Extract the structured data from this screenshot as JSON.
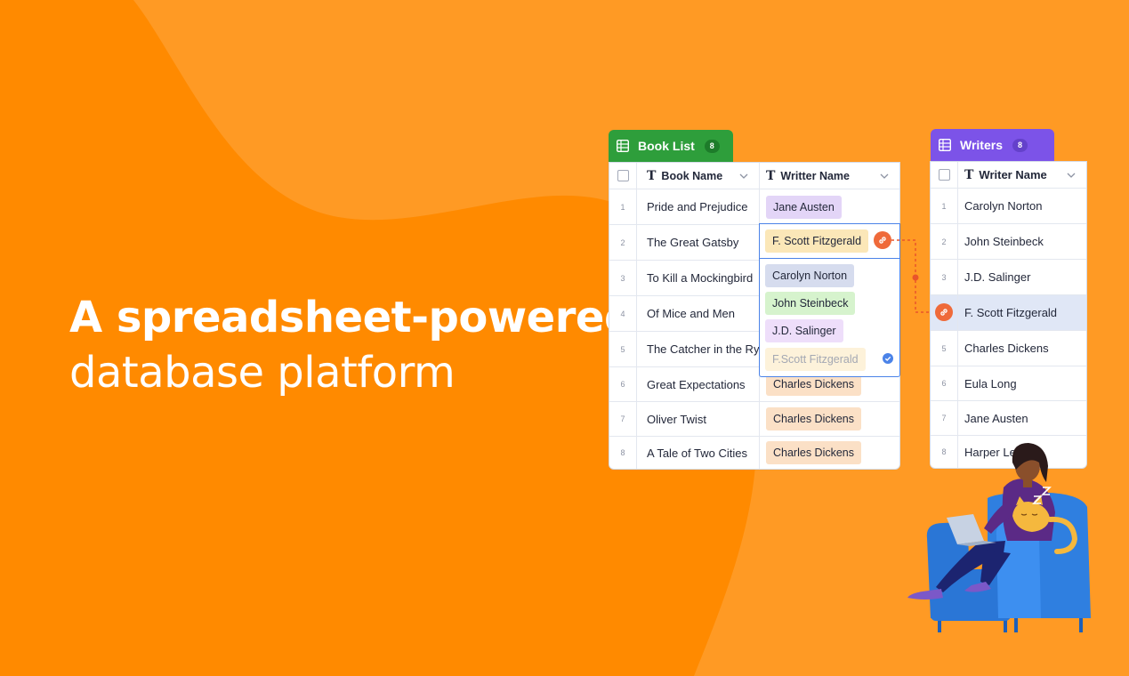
{
  "hero": {
    "line1": "A spreadsheet-powered",
    "line2": "database platform"
  },
  "books_table": {
    "tab_label": "Book List",
    "count": "8",
    "col_book": "Book Name",
    "col_writer": "Writter Name",
    "rows": [
      {
        "num": "1",
        "book": "Pride and Prejudice",
        "writer": "Jane Austen"
      },
      {
        "num": "2",
        "book": "The Great Gatsby",
        "writer": "F. Scott Fitzgerald"
      },
      {
        "num": "3",
        "book": "To Kill a Mockingbird",
        "writer": ""
      },
      {
        "num": "4",
        "book": "Of Mice and Men",
        "writer": ""
      },
      {
        "num": "5",
        "book": "The Catcher in the Rye",
        "writer": ""
      },
      {
        "num": "6",
        "book": "Great Expectations",
        "writer": "Charles Dickens"
      },
      {
        "num": "7",
        "book": "Oliver Twist",
        "writer": "Charles Dickens"
      },
      {
        "num": "8",
        "book": "A Tale of Two Cities",
        "writer": "Charles Dickens"
      }
    ],
    "dropdown_options": [
      "Carolyn Norton",
      "John Steinbeck",
      "J.D. Salinger",
      "F.Scott Fitzgerald"
    ]
  },
  "writers_table": {
    "tab_label": "Writers",
    "count": "8",
    "col_writer": "Writer Name",
    "rows": [
      {
        "num": "1",
        "name": "Carolyn Norton"
      },
      {
        "num": "2",
        "name": "John Steinbeck"
      },
      {
        "num": "3",
        "name": "J.D. Salinger"
      },
      {
        "num": "",
        "name": "F. Scott Fitzgerald"
      },
      {
        "num": "5",
        "name": "Charles Dickens"
      },
      {
        "num": "6",
        "name": "Eula Long"
      },
      {
        "num": "7",
        "name": "Jane Austen"
      },
      {
        "num": "8",
        "name": "Harper Lee"
      }
    ]
  },
  "colors": {
    "bg_primary": "#ff8a00",
    "bg_secondary": "#ff9a24",
    "books_tab": "#2e9e3b",
    "writers_tab": "#7c53e8",
    "selection": "#4b83e8",
    "link": "#ef6a3a"
  },
  "icons": [
    "grid-icon",
    "text-field-icon",
    "chevron-down-icon",
    "link-icon",
    "check-circle-icon",
    "checkbox-icon"
  ]
}
